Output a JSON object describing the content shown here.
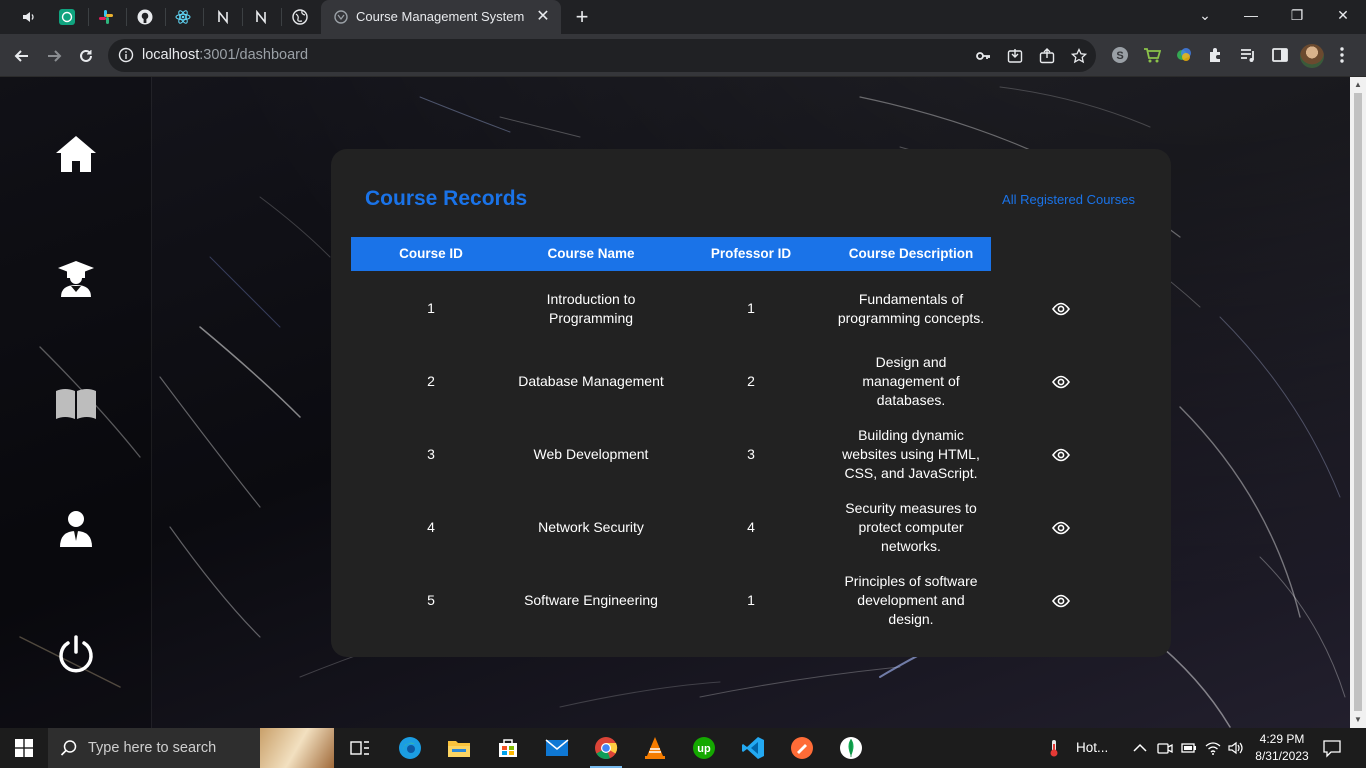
{
  "browser": {
    "pinned_tabs": [
      "speaker-icon",
      "chatgpt-icon",
      "slack-icon",
      "github-icon",
      "react-icon",
      "notion-icon",
      "notion-icon-2",
      "globe-icon"
    ],
    "active_tab_title": "Course Management System",
    "url_host": "localhost",
    "url_path": ":3001/dashboard",
    "window_controls": {
      "minimize": "—",
      "restore": "❐",
      "close": "✕"
    }
  },
  "sidebar": {
    "items": [
      "home-icon",
      "student-icon",
      "book-icon",
      "professor-icon",
      "power-icon"
    ]
  },
  "card": {
    "title": "Course Records",
    "link_label": "All Registered Courses"
  },
  "table": {
    "headers": [
      "Course ID",
      "Course Name",
      "Professor ID",
      "Course Description"
    ],
    "rows": [
      {
        "course_id": "1",
        "course_name": "Introduction to Programming",
        "professor_id": "1",
        "description": "Fundamentals of programming concepts."
      },
      {
        "course_id": "2",
        "course_name": "Database Management",
        "professor_id": "2",
        "description": "Design and management of databases."
      },
      {
        "course_id": "3",
        "course_name": "Web Development",
        "professor_id": "3",
        "description": "Building dynamic websites using HTML, CSS, and JavaScript."
      },
      {
        "course_id": "4",
        "course_name": "Network Security",
        "professor_id": "4",
        "description": "Security measures to protect computer networks."
      },
      {
        "course_id": "5",
        "course_name": "Software Engineering",
        "professor_id": "1",
        "description": "Principles of software development and design."
      }
    ]
  },
  "taskbar": {
    "search_placeholder": "Type here to search",
    "apps": [
      "task-view-icon",
      "edge-icon",
      "file-explorer-icon",
      "store-icon",
      "mail-icon",
      "chrome-icon",
      "vlc-icon",
      "upwork-icon",
      "vscode-icon",
      "postman-icon",
      "mongodb-icon"
    ],
    "weather_label": "Hot...",
    "time": "4:29 PM",
    "date": "8/31/2023"
  },
  "colors": {
    "accent": "#1a73e8",
    "card_bg": "#222222",
    "chrome_bg": "#202124"
  }
}
